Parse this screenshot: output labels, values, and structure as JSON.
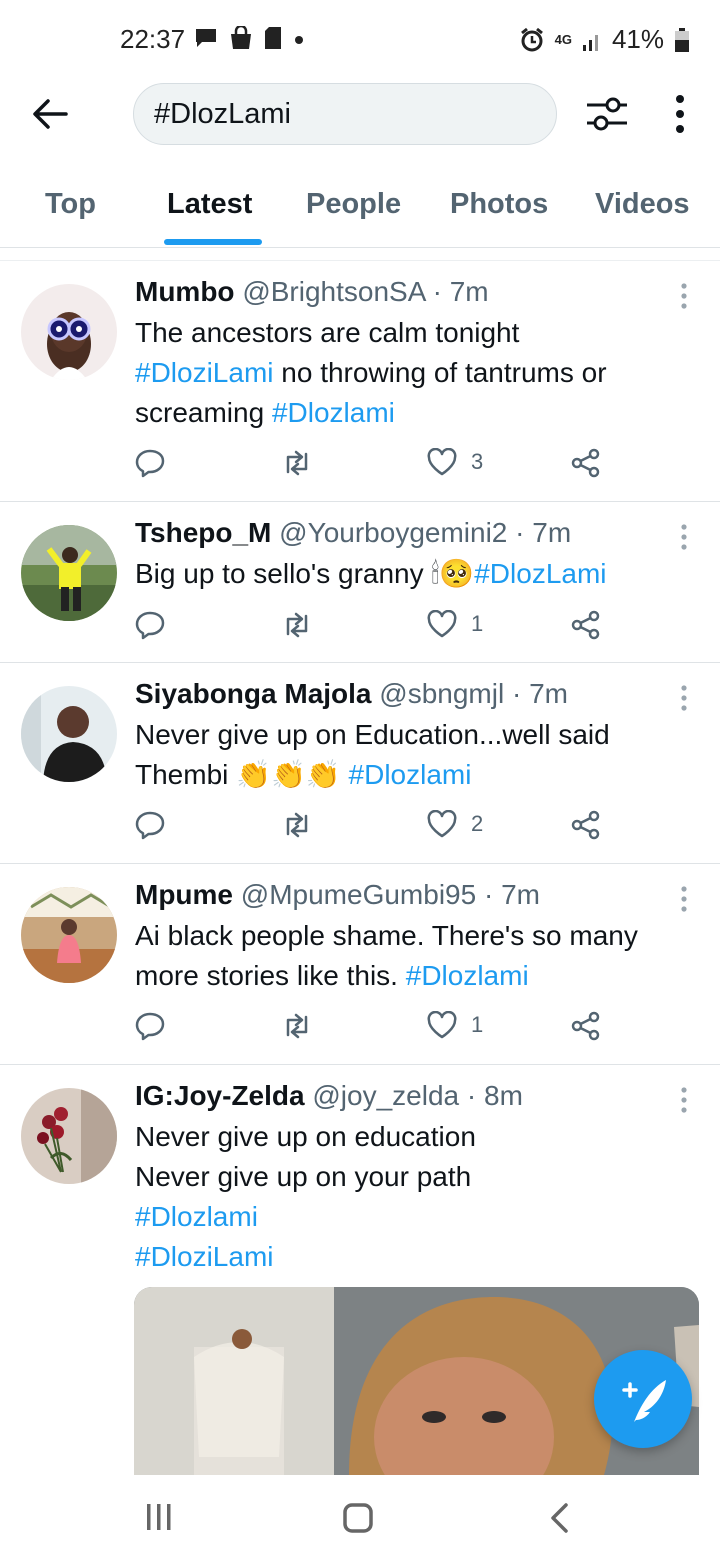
{
  "status_bar": {
    "time": "22:37",
    "battery": "41%",
    "network": "4G",
    "left_icons": [
      "chat-icon",
      "shopping-bag-icon",
      "sim-icon",
      "dot-icon"
    ],
    "right_icons": [
      "alarm-icon",
      "network-4g-icon",
      "signal-icon",
      "battery-icon"
    ]
  },
  "search": {
    "value": "#DlozLami"
  },
  "tabs": [
    {
      "label": "Top",
      "active": false
    },
    {
      "label": "Latest",
      "active": true
    },
    {
      "label": "People",
      "active": false
    },
    {
      "label": "Photos",
      "active": false
    },
    {
      "label": "Videos",
      "active": false
    }
  ],
  "tweets": [
    {
      "name": "Mumbo",
      "handle": "@BrightsonSA",
      "time": "7m",
      "text_lines": [
        [
          {
            "t": "The ancestors are calm tonight",
            "tag": false
          }
        ],
        [
          {
            "t": "#DloziLami",
            "tag": true
          },
          {
            "t": " no throwing of tantrums or",
            "tag": false
          }
        ],
        [
          {
            "t": "screaming ",
            "tag": false
          },
          {
            "t": "#Dlozlami",
            "tag": true
          }
        ]
      ],
      "likes": "3"
    },
    {
      "name": "Tshepo_M",
      "handle": "@Yourboygemini2",
      "time": "7m",
      "text_lines": [
        [
          {
            "t": "Big up to sello's granny ",
            "tag": false
          },
          {
            "t": "🕯🥺",
            "tag": false
          },
          {
            "t": "#DlozLami",
            "tag": true
          }
        ]
      ],
      "likes": "1"
    },
    {
      "name": "Siyabonga Majola",
      "handle": "@sbngmjl",
      "time": "7m",
      "text_lines": [
        [
          {
            "t": "Never give up on Education...well said",
            "tag": false
          }
        ],
        [
          {
            "t": "Thembi ",
            "tag": false
          },
          {
            "t": "👏👏👏",
            "tag": false
          },
          {
            "t": " #Dlozlami",
            "tag": true
          }
        ]
      ],
      "likes": "2"
    },
    {
      "name": "Mpume",
      "handle": "@MpumeGumbi95",
      "time": "7m",
      "text_lines": [
        [
          {
            "t": "Ai black people shame. There's so many",
            "tag": false
          }
        ],
        [
          {
            "t": "more stories like this. ",
            "tag": false
          },
          {
            "t": "#Dlozlami",
            "tag": true
          }
        ]
      ],
      "likes": "1"
    },
    {
      "name": "IG:Joy-Zelda",
      "handle": "@joy_zelda",
      "time": "8m",
      "text_lines": [
        [
          {
            "t": "Never give up on education",
            "tag": false
          }
        ],
        [
          {
            "t": "Never give up on your path",
            "tag": false
          }
        ],
        [
          {
            "t": "#Dlozlami",
            "tag": true
          }
        ],
        [
          {
            "t": "#DloziLami",
            "tag": true
          }
        ]
      ],
      "likes": ""
    }
  ],
  "colors": {
    "accent": "#1d9bf0",
    "text": "#0f1419",
    "muted": "#536471",
    "divider": "#dfe3e6"
  }
}
